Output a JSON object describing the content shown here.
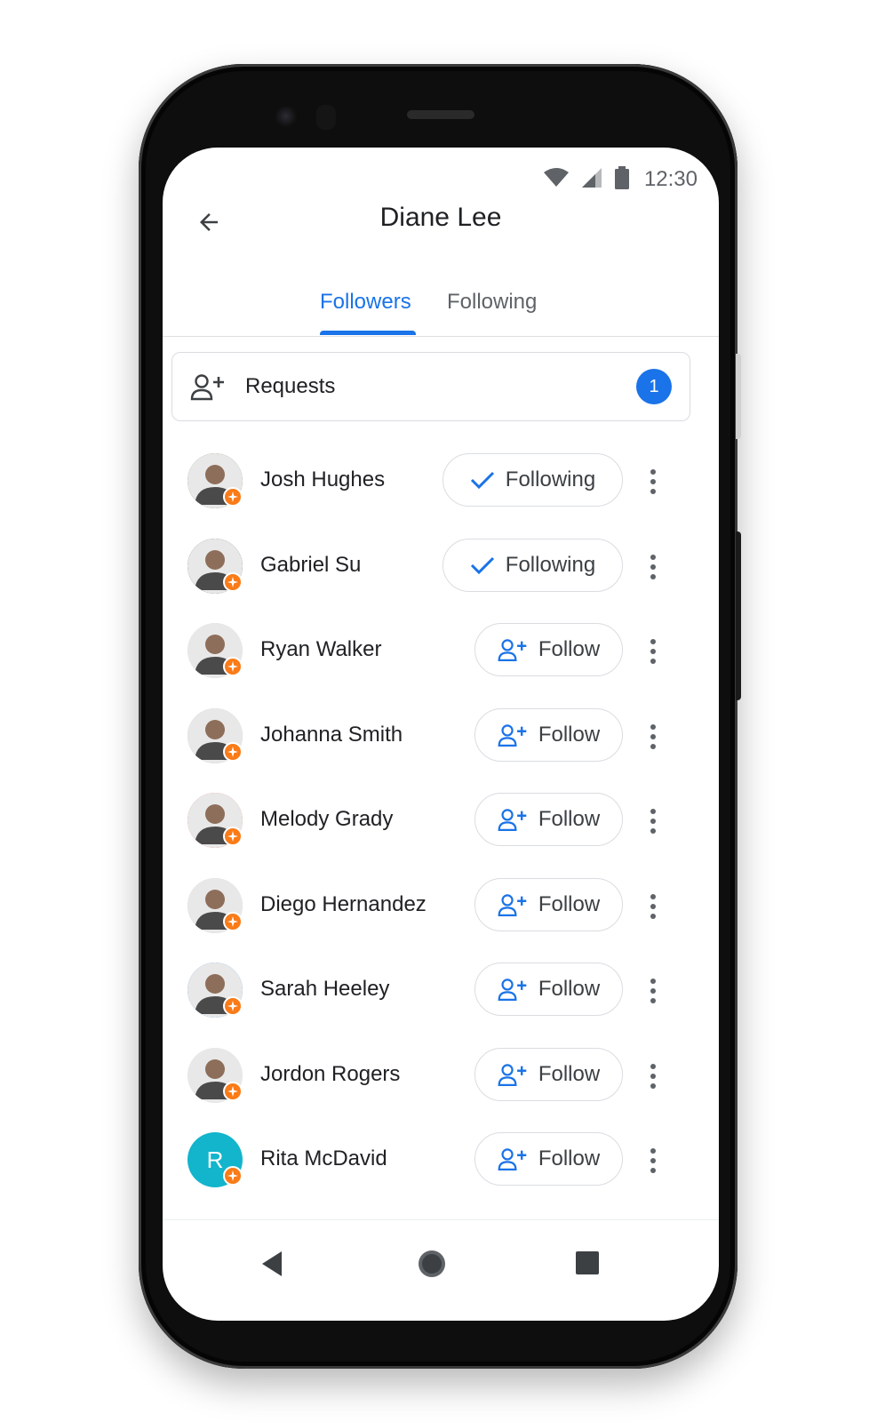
{
  "status_bar": {
    "time": "12:30",
    "icons": [
      "wifi-icon",
      "cellular-signal-icon",
      "battery-icon"
    ]
  },
  "app_bar": {
    "title": "Diane Lee",
    "back_icon": "arrow-back-icon"
  },
  "tabs": [
    {
      "label": "Followers",
      "active": true
    },
    {
      "label": "Following",
      "active": false
    }
  ],
  "requests": {
    "label": "Requests",
    "count": "1",
    "icon": "person-add-icon"
  },
  "people": [
    {
      "name": "Josh Hughes",
      "button": "Following",
      "state": "following",
      "avatar_color": "#5a7f3a"
    },
    {
      "name": "Gabriel Su",
      "button": "Following",
      "state": "following",
      "avatar_color": "#3b4a5c"
    },
    {
      "name": "Ryan Walker",
      "button": "Follow",
      "state": "follow",
      "avatar_color": "#d9d6d2"
    },
    {
      "name": "Johanna Smith",
      "button": "Follow",
      "state": "follow",
      "avatar_color": "#c9b79a"
    },
    {
      "name": "Melody Grady",
      "button": "Follow",
      "state": "follow",
      "avatar_color": "#e0645a"
    },
    {
      "name": "Diego Hernandez",
      "button": "Follow",
      "state": "follow",
      "avatar_color": "#c8c8c8"
    },
    {
      "name": "Sarah Heeley",
      "button": "Follow",
      "state": "follow",
      "avatar_color": "#3d86c6"
    },
    {
      "name": "Jordon Rogers",
      "button": "Follow",
      "state": "follow",
      "avatar_color": "#e4e4e4"
    },
    {
      "name": "Rita McDavid",
      "button": "Follow",
      "state": "follow",
      "avatar_color": "#12b5cb",
      "avatar_initial": "R"
    }
  ],
  "nav_bar": {
    "icons": [
      "nav-back-icon",
      "nav-home-icon",
      "nav-recents-icon"
    ]
  },
  "colors": {
    "accent": "#1a73e8",
    "badge_orange": "#fa7b17",
    "text_primary": "#202124",
    "text_secondary": "#5f6368"
  }
}
